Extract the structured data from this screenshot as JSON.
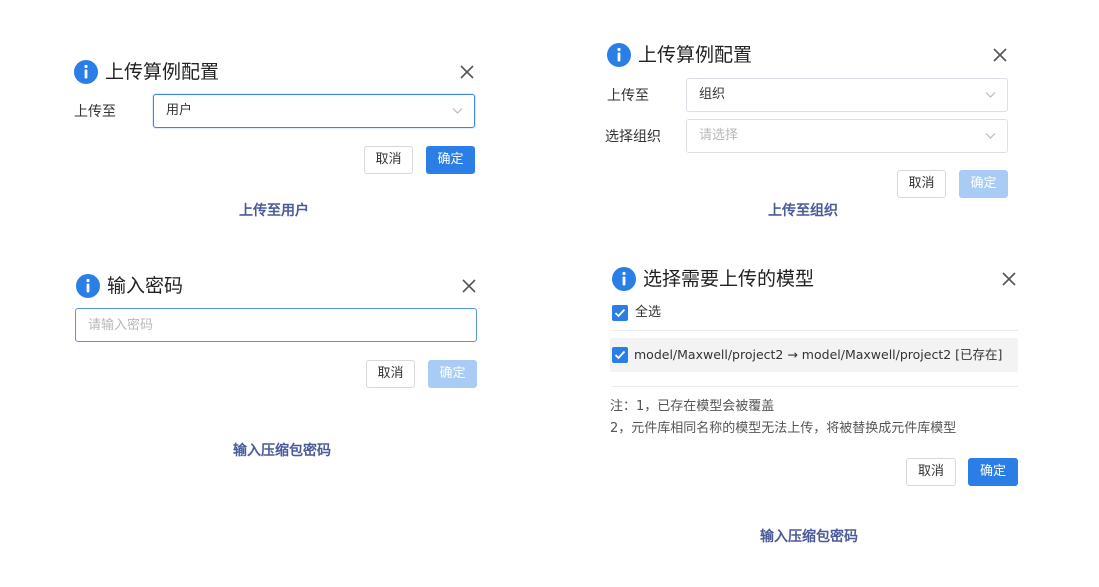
{
  "dialog1": {
    "title": "上传算例配置",
    "upload_label": "上传至",
    "upload_value": "用户",
    "cancel_label": "取消",
    "ok_label": "确定",
    "caption": "上传至用户"
  },
  "dialog2": {
    "title": "上传算例配置",
    "upload_label": "上传至",
    "upload_value": "组织",
    "org_label": "选择组织",
    "org_placeholder": "请选择",
    "cancel_label": "取消",
    "ok_label": "确定",
    "caption": "上传至组织"
  },
  "dialog3": {
    "title": "输入密码",
    "password_placeholder": "请输入密码",
    "cancel_label": "取消",
    "ok_label": "确定",
    "caption": "输入压缩包密码"
  },
  "dialog4": {
    "title": "选择需要上传的模型",
    "select_all_label": "全选",
    "model_item_label": "model/Maxwell/project2 → model/Maxwell/project2 [已存在]",
    "note_line1": "注：1，已存在模型会被覆盖",
    "note_line2": "2，元件库相同名称的模型无法上传，将被替换成元件库模型",
    "cancel_label": "取消",
    "ok_label": "确定",
    "caption": "输入压缩包密码"
  },
  "colors": {
    "primary": "#2b7ee6",
    "primary_disabled": "#a9ccf5",
    "caption": "#4a5b9a",
    "border": "#dcdfe6"
  }
}
